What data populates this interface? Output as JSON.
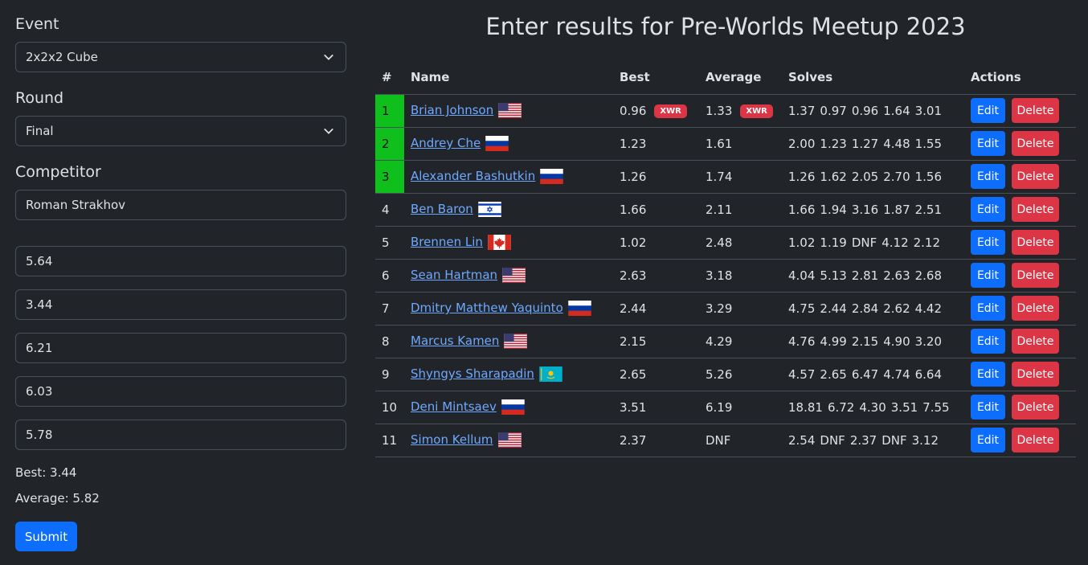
{
  "form": {
    "event_label": "Event",
    "event_value": "2x2x2 Cube",
    "round_label": "Round",
    "round_value": "Final",
    "competitor_label": "Competitor",
    "competitor_value": "Roman Strakhov",
    "times": [
      "5.64",
      "3.44",
      "6.21",
      "6.03",
      "5.78"
    ],
    "best_text": "Best: 3.44",
    "average_text": "Average: 5.82",
    "submit_label": "Submit"
  },
  "title": "Enter results for Pre-Worlds Meetup 2023",
  "table": {
    "headers": [
      "#",
      "Name",
      "Best",
      "Average",
      "Solves",
      "Actions"
    ],
    "edit_label": "Edit",
    "delete_label": "Delete",
    "rows": [
      {
        "rank": "1",
        "name": "Brian Johnson",
        "flag": "us",
        "best": "0.96",
        "best_badge": "XWR",
        "average": "1.33",
        "average_badge": "XWR",
        "solves": [
          "1.37",
          "0.97",
          "0.96",
          "1.64",
          "3.01"
        ],
        "podium": true
      },
      {
        "rank": "2",
        "name": "Andrey Che",
        "flag": "ru",
        "best": "1.23",
        "average": "1.61",
        "solves": [
          "2.00",
          "1.23",
          "1.27",
          "4.48",
          "1.55"
        ],
        "podium": true
      },
      {
        "rank": "3",
        "name": "Alexander Bashutkin",
        "flag": "ru",
        "best": "1.26",
        "average": "1.74",
        "solves": [
          "1.26",
          "1.62",
          "2.05",
          "2.70",
          "1.56"
        ],
        "podium": true
      },
      {
        "rank": "4",
        "name": "Ben Baron",
        "flag": "il",
        "best": "1.66",
        "average": "2.11",
        "solves": [
          "1.66",
          "1.94",
          "3.16",
          "1.87",
          "2.51"
        ],
        "podium": false
      },
      {
        "rank": "5",
        "name": "Brennen Lin",
        "flag": "ca",
        "best": "1.02",
        "average": "2.48",
        "solves": [
          "1.02",
          "1.19",
          "DNF",
          "4.12",
          "2.12"
        ],
        "podium": false
      },
      {
        "rank": "6",
        "name": "Sean Hartman",
        "flag": "us",
        "best": "2.63",
        "average": "3.18",
        "solves": [
          "4.04",
          "5.13",
          "2.81",
          "2.63",
          "2.68"
        ],
        "podium": false
      },
      {
        "rank": "7",
        "name": "Dmitry Matthew Yaquinto",
        "flag": "ru",
        "best": "2.44",
        "average": "3.29",
        "solves": [
          "4.75",
          "2.44",
          "2.84",
          "2.62",
          "4.42"
        ],
        "podium": false
      },
      {
        "rank": "8",
        "name": "Marcus Kamen",
        "flag": "us",
        "best": "2.15",
        "average": "4.29",
        "solves": [
          "4.76",
          "4.99",
          "2.15",
          "4.90",
          "3.20"
        ],
        "podium": false
      },
      {
        "rank": "9",
        "name": "Shyngys Sharapadin",
        "flag": "kz",
        "best": "2.65",
        "average": "5.26",
        "solves": [
          "4.57",
          "2.65",
          "6.47",
          "4.74",
          "6.64"
        ],
        "podium": false
      },
      {
        "rank": "10",
        "name": "Deni Mintsaev",
        "flag": "ru",
        "best": "3.51",
        "average": "6.19",
        "solves": [
          "18.81",
          "6.72",
          "4.30",
          "3.51",
          "7.55"
        ],
        "podium": false
      },
      {
        "rank": "11",
        "name": "Simon Kellum",
        "flag": "us",
        "best": "2.37",
        "average": "DNF",
        "solves": [
          "2.54",
          "DNF",
          "2.37",
          "DNF",
          "3.12"
        ],
        "podium": false
      }
    ]
  },
  "colors": {
    "podium": "#0fbf1c",
    "primary": "#0d6efd",
    "danger": "#dc3545",
    "link": "#6ea8fe"
  }
}
